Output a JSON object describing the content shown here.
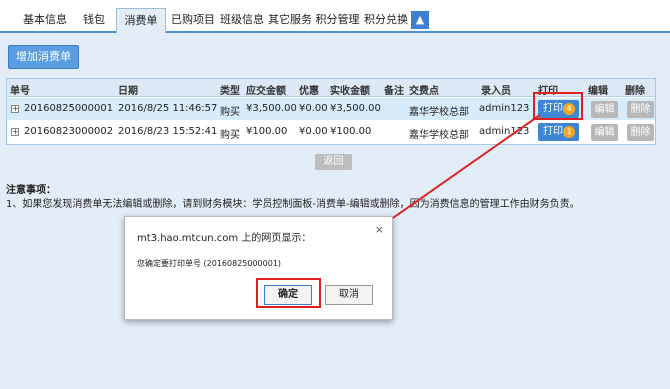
{
  "tabs": [
    "基本信息",
    "钱包",
    "消费单",
    "已购项目",
    "班级信息",
    "其它服务",
    "积分管理",
    "积分兑换"
  ],
  "tab_arrow": "▲",
  "toolbar": {
    "add_label": "增加消费单"
  },
  "table": {
    "headers": [
      "单号",
      "日期",
      "类型",
      "应交金额",
      "优惠",
      "实收金额",
      "备注",
      "交费点",
      "录入员",
      "打印",
      "编辑",
      "删除"
    ],
    "rows": [
      {
        "expand": "+",
        "id": "20160825000001",
        "date": "2016/8/25 11:46:57",
        "type": "购买",
        "due": "¥3,500.00",
        "discount": "¥0.00",
        "received": "¥3,500.00",
        "note": "",
        "location": "嘉华学校总部",
        "operator": "admin123",
        "print": "打印",
        "print_count": "4",
        "edit": "编辑",
        "delete": "删除"
      },
      {
        "expand": "+",
        "id": "20160823000002",
        "date": "2016/8/23 15:52:41",
        "type": "购买",
        "due": "¥100.00",
        "discount": "¥0.00",
        "received": "¥100.00",
        "note": "",
        "location": "嘉华学校总部",
        "operator": "admin123",
        "print": "打印",
        "print_count": "1",
        "edit": "编辑",
        "delete": "删除"
      }
    ]
  },
  "back_label": "返回",
  "notes": {
    "title": "注意事项：",
    "text": "1、如果您发现消费单无法编辑或删除，请到财务模块：学员控制面板-消费单-编辑或删除，因为消费信息的管理工作由财务负责。"
  },
  "dialog": {
    "title": "mt3.hao.mtcun.com 上的网页显示：",
    "close": "×",
    "message": "您确定要打印单号 (20160825000001)",
    "ok": "确定",
    "cancel": "取消"
  },
  "colors": {
    "accent": "#3f85d6",
    "highlight": "#e02020",
    "badge": "#f5a623"
  }
}
